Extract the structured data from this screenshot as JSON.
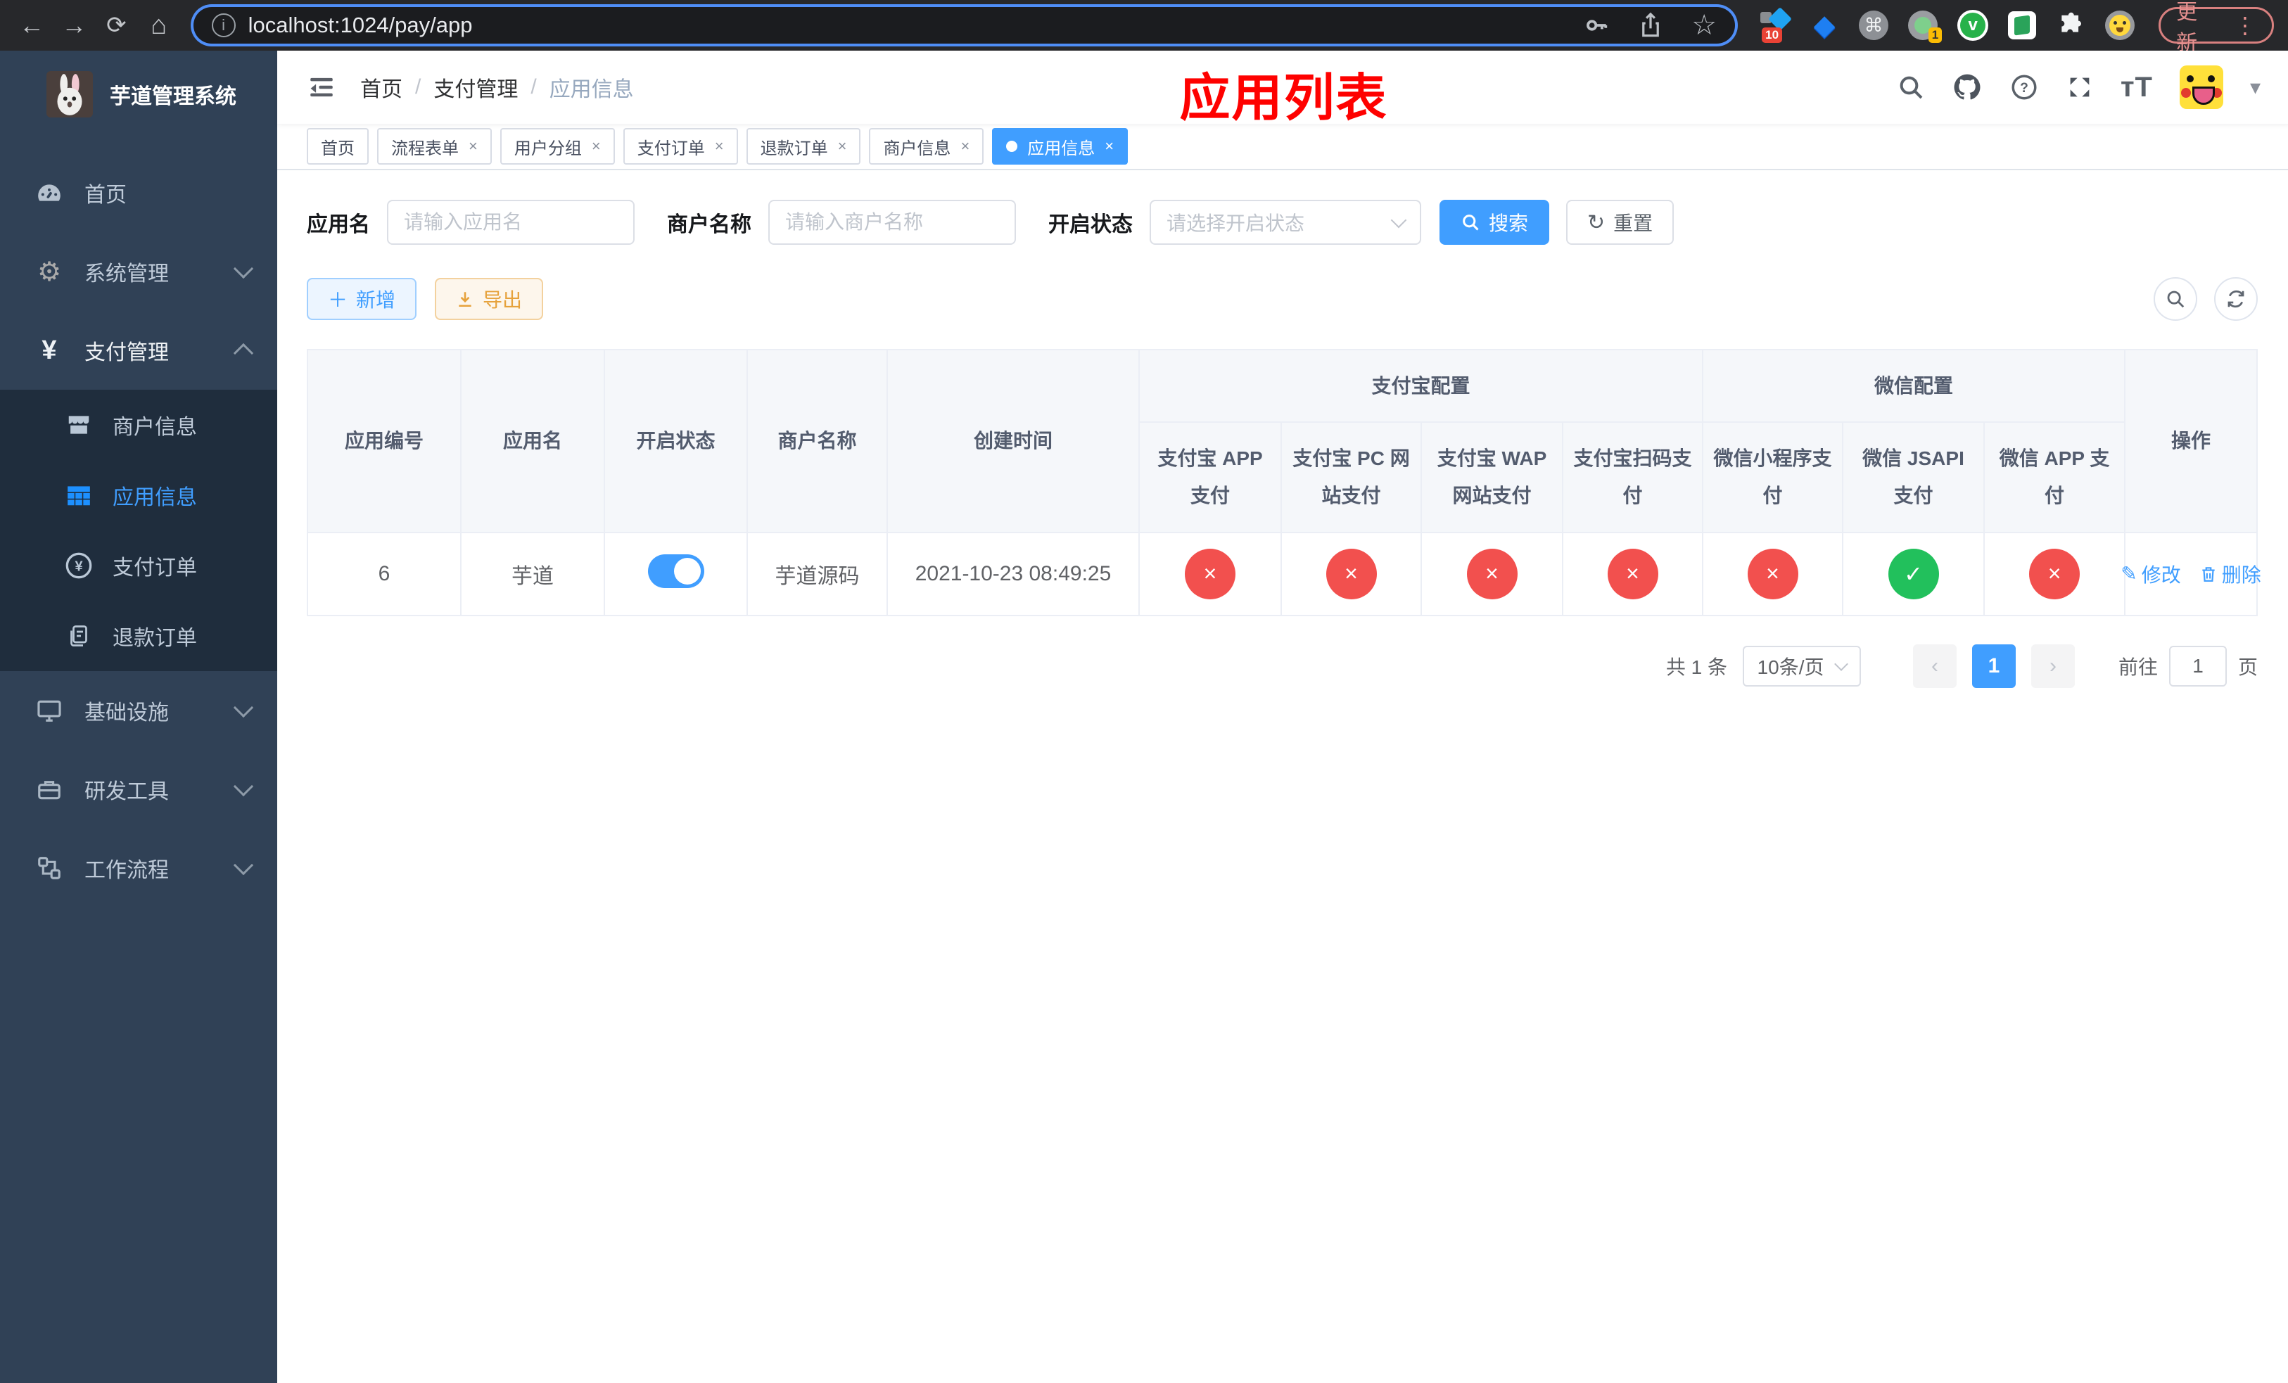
{
  "colors": {
    "accent": "#409eff",
    "success": "#22c05c",
    "danger": "#f2504e",
    "sidebar_bg": "#304156",
    "submenu_bg": "#1f2d3d",
    "annotation_red": "#fe0100"
  },
  "browser": {
    "url": "localhost:1024/pay/app",
    "update_label": "更新",
    "ext_badge_pin": "10",
    "ext_badge_proxy": "1"
  },
  "sidebar": {
    "title": "芋道管理系统",
    "menu": [
      {
        "label": "首页"
      },
      {
        "label": "系统管理"
      },
      {
        "label": "支付管理"
      },
      {
        "label": "基础设施"
      },
      {
        "label": "研发工具"
      },
      {
        "label": "工作流程"
      }
    ],
    "submenu": [
      {
        "label": "商户信息"
      },
      {
        "label": "应用信息"
      },
      {
        "label": "支付订单"
      },
      {
        "label": "退款订单"
      }
    ]
  },
  "header": {
    "breadcrumb": {
      "home": "首页",
      "section": "支付管理",
      "current": "应用信息"
    },
    "annotation": "应用列表"
  },
  "tabs": [
    {
      "label": "首页"
    },
    {
      "label": "流程表单"
    },
    {
      "label": "用户分组"
    },
    {
      "label": "支付订单"
    },
    {
      "label": "退款订单"
    },
    {
      "label": "商户信息"
    },
    {
      "label": "应用信息"
    }
  ],
  "filters": {
    "app_name_label": "应用名",
    "app_name_placeholder": "请输入应用名",
    "merchant_label": "商户名称",
    "merchant_placeholder": "请输入商户名称",
    "status_label": "开启状态",
    "status_placeholder": "请选择开启状态",
    "search_label": "搜索",
    "reset_label": "重置"
  },
  "toolbar": {
    "add_label": "新增",
    "export_label": "导出"
  },
  "table": {
    "groups": {
      "alipay": "支付宝配置",
      "wechat": "微信配置"
    },
    "columns": {
      "id": "应用编号",
      "name": "应用名",
      "status": "开启状态",
      "merchant": "商户名称",
      "created": "创建时间",
      "alipay_app": "支付宝 APP 支付",
      "alipay_pc": "支付宝 PC 网站支付",
      "alipay_wap": "支付宝 WAP 网站支付",
      "alipay_qr": "支付宝扫码支付",
      "wx_mini": "微信小程序支付",
      "wx_jsapi": "微信 JSAPI 支付",
      "wx_app": "微信 APP 支付",
      "actions": "操作"
    },
    "row": {
      "id": "6",
      "name": "芋道",
      "status_on": true,
      "merchant": "芋道源码",
      "created": "2021-10-23 08:49:25",
      "configs": [
        "no",
        "no",
        "no",
        "no",
        "no",
        "yes",
        "no"
      ],
      "edit_label": "修改",
      "delete_label": "删除"
    }
  },
  "pagination": {
    "total": "共 1 条",
    "page_size": "10条/页",
    "current_page": "1",
    "goto_label": "前往",
    "goto_value": "1",
    "page_suffix": "页"
  }
}
